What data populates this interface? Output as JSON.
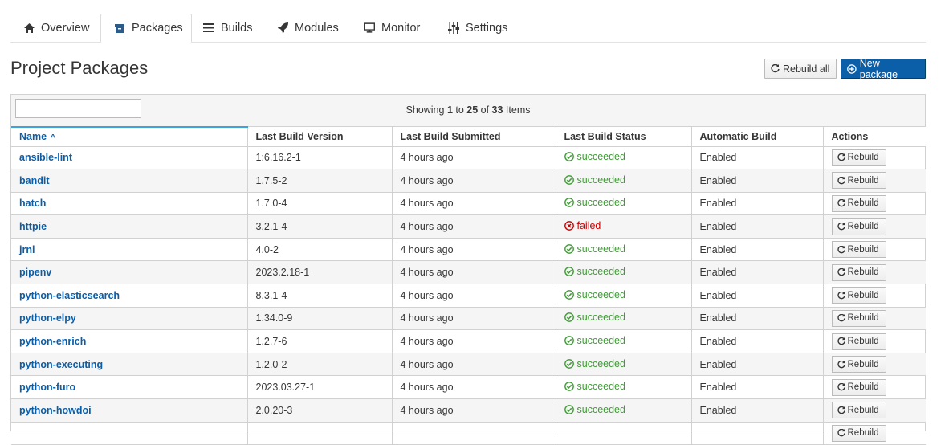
{
  "tabs": [
    {
      "label": "Overview",
      "icon": "home-icon",
      "active": false
    },
    {
      "label": "Packages",
      "icon": "archive-icon",
      "active": true
    },
    {
      "label": "Builds",
      "icon": "list-icon",
      "active": false
    },
    {
      "label": "Modules",
      "icon": "rocket-icon",
      "active": false
    },
    {
      "label": "Monitor",
      "icon": "desktop-icon",
      "active": false
    },
    {
      "label": "Settings",
      "icon": "sliders-icon",
      "active": false
    }
  ],
  "header": {
    "title": "Project Packages",
    "rebuild_all_label": "Rebuild all",
    "new_package_label": "New package"
  },
  "toolbar": {
    "search_value": "",
    "showing_prefix": "Showing ",
    "range_start": "1",
    "to_word": " to ",
    "range_end": "25",
    "of_word": " of ",
    "total": "33",
    "items_word": " Items"
  },
  "table": {
    "columns": [
      "Name",
      "Last Build Version",
      "Last Build Submitted",
      "Last Build Status",
      "Automatic Build",
      "Actions"
    ],
    "sort_indicator": "^",
    "rebuild_label": "Rebuild",
    "rows": [
      {
        "name": "ansible-lint",
        "version": "1:6.16.2-1",
        "submitted": "4 hours ago",
        "status": "succeeded",
        "auto": "Enabled"
      },
      {
        "name": "bandit",
        "version": "1.7.5-2",
        "submitted": "4 hours ago",
        "status": "succeeded",
        "auto": "Enabled"
      },
      {
        "name": "hatch",
        "version": "1.7.0-4",
        "submitted": "4 hours ago",
        "status": "succeeded",
        "auto": "Enabled"
      },
      {
        "name": "httpie",
        "version": "3.2.1-4",
        "submitted": "4 hours ago",
        "status": "failed",
        "auto": "Enabled"
      },
      {
        "name": "jrnl",
        "version": "4.0-2",
        "submitted": "4 hours ago",
        "status": "succeeded",
        "auto": "Enabled"
      },
      {
        "name": "pipenv",
        "version": "2023.2.18-1",
        "submitted": "4 hours ago",
        "status": "succeeded",
        "auto": "Enabled"
      },
      {
        "name": "python-elasticsearch",
        "version": "8.3.1-4",
        "submitted": "4 hours ago",
        "status": "succeeded",
        "auto": "Enabled"
      },
      {
        "name": "python-elpy",
        "version": "1.34.0-9",
        "submitted": "4 hours ago",
        "status": "succeeded",
        "auto": "Enabled"
      },
      {
        "name": "python-enrich",
        "version": "1.2.7-6",
        "submitted": "4 hours ago",
        "status": "succeeded",
        "auto": "Enabled"
      },
      {
        "name": "python-executing",
        "version": "1.2.0-2",
        "submitted": "4 hours ago",
        "status": "succeeded",
        "auto": "Enabled"
      },
      {
        "name": "python-furo",
        "version": "2023.03.27-1",
        "submitted": "4 hours ago",
        "status": "succeeded",
        "auto": "Enabled"
      },
      {
        "name": "python-howdoi",
        "version": "2.0.20-3",
        "submitted": "4 hours ago",
        "status": "succeeded",
        "auto": "Enabled"
      },
      {
        "name": "",
        "version": "",
        "submitted": "",
        "status": "",
        "auto": ""
      }
    ]
  },
  "colors": {
    "link": "#0b5ea8",
    "success": "#3f9c35",
    "danger": "#cc0000",
    "primary_button": "#0b5ea8"
  }
}
